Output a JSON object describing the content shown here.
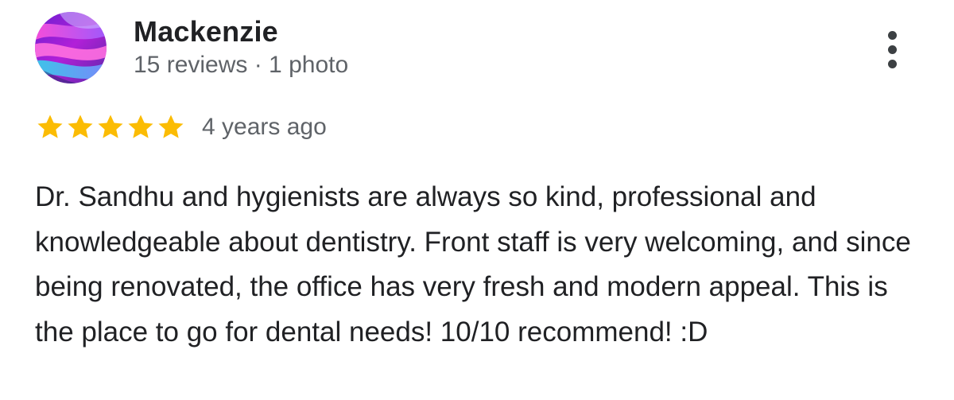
{
  "reviewer": {
    "name": "Mackenzie",
    "meta": "15 reviews · 1 photo"
  },
  "review": {
    "rating": 5,
    "date": "4 years ago",
    "text": "Dr. Sandhu and hygienists are always so kind, professional and knowledgeable about dentistry. Front staff is very welcoming, and since being renovated, the office has very fresh and modern appeal. This is the place to go for dental needs! 10/10 recommend! :D"
  },
  "icons": {
    "more": "more-vert-icon",
    "star": "star-icon"
  },
  "colors": {
    "star": "#fbbc04",
    "name": "#202124",
    "secondary_text": "#5f6368"
  }
}
